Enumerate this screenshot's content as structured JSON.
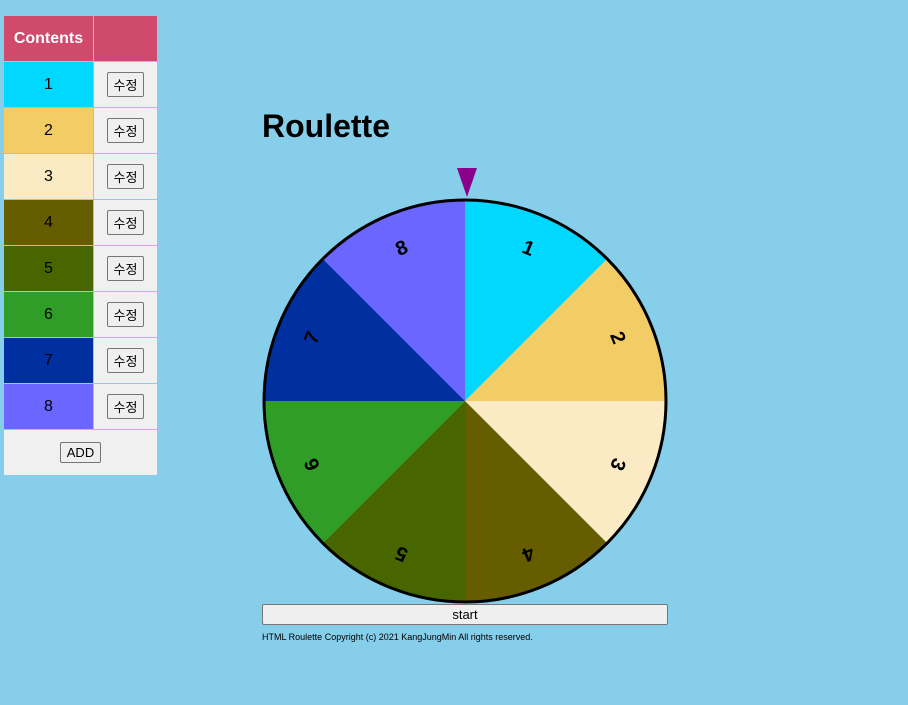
{
  "table": {
    "header": "Contents",
    "rows": [
      {
        "label": "1",
        "color": "#00d8ff",
        "edit_label": "수정"
      },
      {
        "label": "2",
        "color": "#f2cd66",
        "edit_label": "수정"
      },
      {
        "label": "3",
        "color": "#faebc5",
        "edit_label": "수정"
      },
      {
        "label": "4",
        "color": "#665c00",
        "edit_label": "수정"
      },
      {
        "label": "5",
        "color": "#476600",
        "edit_label": "수정"
      },
      {
        "label": "6",
        "color": "#2f9d27",
        "edit_label": "수정"
      },
      {
        "label": "7",
        "color": "#0030a0",
        "edit_label": "수정"
      },
      {
        "label": "8",
        "color": "#6b66ff",
        "edit_label": "수정"
      }
    ],
    "add_label": "ADD"
  },
  "title": "Roulette",
  "pointer_color": "#8b008b",
  "wheel": {
    "segments": [
      "1",
      "2",
      "3",
      "4",
      "5",
      "6",
      "7",
      "8"
    ]
  },
  "start_label": "start",
  "copyright": "HTML Roulette Copyright (c) 2021 KangJungMin All rights reserved."
}
